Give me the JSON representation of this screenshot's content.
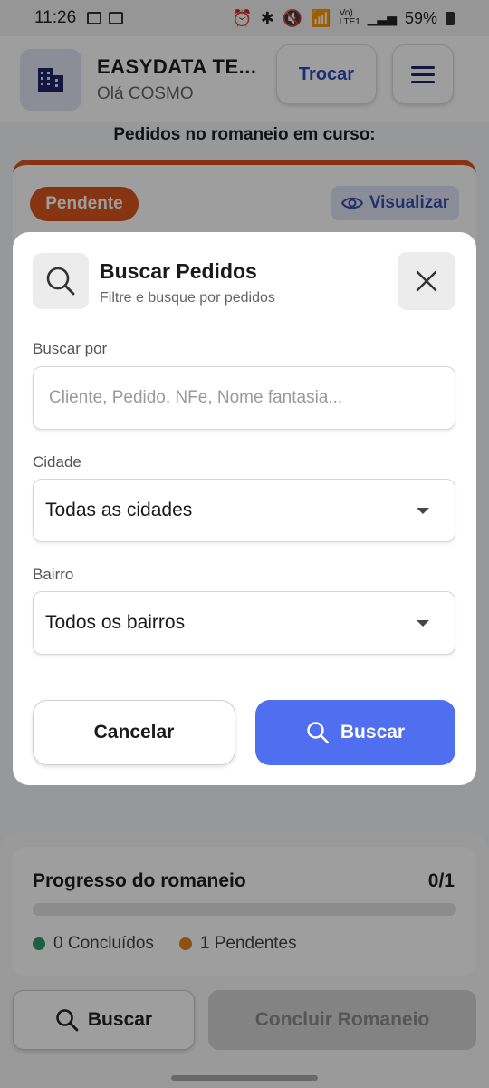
{
  "status_bar": {
    "time": "11:26",
    "battery": "59%",
    "signal_text": "Vo) LTE1"
  },
  "header": {
    "company_name": "EASYDATA TE...",
    "greeting": "Olá COSMO",
    "swap_label": "Trocar"
  },
  "section_title": "Pedidos no romaneio em curso:",
  "order_card": {
    "status": "Pendente",
    "view_label": "Visualizar"
  },
  "modal": {
    "title": "Buscar Pedidos",
    "subtitle": "Filtre e busque por pedidos",
    "search": {
      "label": "Buscar por",
      "placeholder": "Cliente, Pedido, NFe, Nome fantasia..."
    },
    "city": {
      "label": "Cidade",
      "value": "Todas as cidades"
    },
    "district": {
      "label": "Bairro",
      "value": "Todos os bairros"
    },
    "cancel_label": "Cancelar",
    "search_label": "Buscar"
  },
  "progress": {
    "title": "Progresso do romaneio",
    "count": "0/1",
    "completed_fraction": 0,
    "completed_label": "0 Concluídos",
    "pending_label": "1 Pendentes"
  },
  "actions": {
    "search_label": "Buscar",
    "conclude_label": "Concluir Romaneio"
  },
  "colors": {
    "primary": "#4f6ff0",
    "pending": "#d9541e",
    "completed_dot": "#2e9b6a",
    "pending_dot": "#e0861a",
    "brand_dark": "#1f2666"
  }
}
